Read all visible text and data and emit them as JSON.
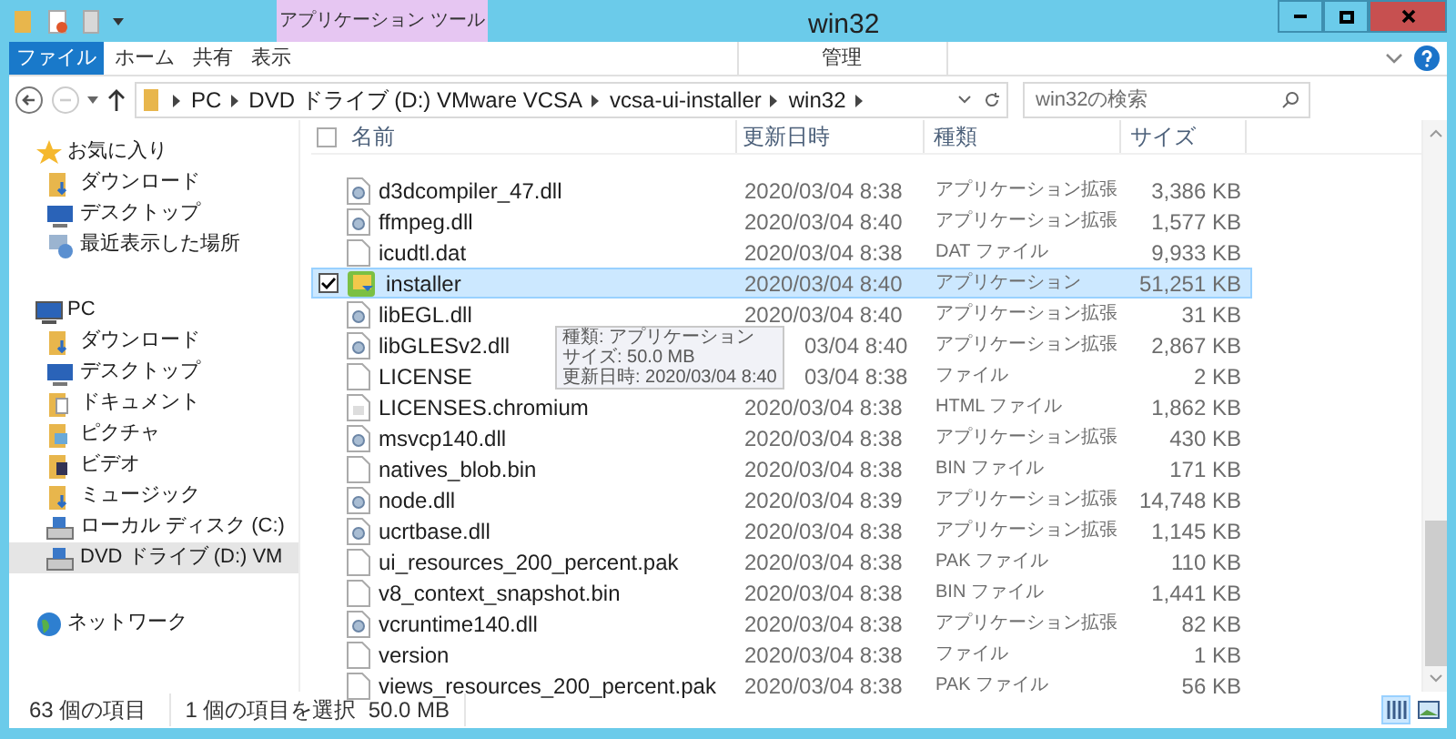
{
  "window": {
    "title": "win32",
    "context_tab": "アプリケーション ツール"
  },
  "ribbon_tabs": [
    {
      "label": "ファイル",
      "kind": "file"
    },
    {
      "label": "ホーム",
      "kind": "tab"
    },
    {
      "label": "共有",
      "kind": "tab"
    },
    {
      "label": "表示",
      "kind": "tab"
    },
    {
      "label": "管理",
      "kind": "context"
    }
  ],
  "address": {
    "crumbs": [
      "PC",
      "DVD ドライブ (D:) VMware VCSA",
      "vcsa-ui-installer",
      "win32"
    ]
  },
  "search": {
    "placeholder": "win32の検索"
  },
  "sidebar": {
    "groups": [
      {
        "label": "お気に入り",
        "kind": "star",
        "children": [
          {
            "label": "ダウンロード",
            "kind": "download",
            "selected": false
          },
          {
            "label": "デスクトップ",
            "kind": "desktop",
            "selected": false
          },
          {
            "label": "最近表示した場所",
            "kind": "recent",
            "selected": false
          }
        ]
      },
      {
        "label": "PC",
        "kind": "pc",
        "children": [
          {
            "label": "ダウンロード",
            "kind": "download",
            "selected": false
          },
          {
            "label": "デスクトップ",
            "kind": "desktop",
            "selected": false
          },
          {
            "label": "ドキュメント",
            "kind": "document",
            "selected": false
          },
          {
            "label": "ピクチャ",
            "kind": "folder",
            "selected": false
          },
          {
            "label": "ビデオ",
            "kind": "video",
            "selected": false
          },
          {
            "label": "ミュージック",
            "kind": "download",
            "selected": false
          },
          {
            "label": "ローカル ディスク (C:)",
            "kind": "disk",
            "selected": false
          },
          {
            "label": "DVD ドライブ (D:) VM",
            "kind": "disk",
            "selected": true
          }
        ]
      },
      {
        "label": "ネットワーク",
        "kind": "network"
      }
    ]
  },
  "table": {
    "select_all": {
      "checked": false
    },
    "columns": [
      "名前",
      "更新日時",
      "種類",
      "サイズ"
    ],
    "rows": [
      {
        "name": "d3dcompiler_47.dll",
        "kind": "dll",
        "date": "2020/03/04 8:38",
        "type": "アプリケーション拡張",
        "size": "3,386 KB",
        "selected": false
      },
      {
        "name": "ffmpeg.dll",
        "kind": "dll",
        "date": "2020/03/04 8:40",
        "type": "アプリケーション拡張",
        "size": "1,577 KB",
        "selected": false
      },
      {
        "name": "icudtl.dat",
        "kind": "file",
        "date": "2020/03/04 8:38",
        "type": "DAT ファイル",
        "size": "9,933 KB",
        "selected": false
      },
      {
        "name": "installer",
        "kind": "app",
        "date": "2020/03/04 8:40",
        "type": "アプリケーション",
        "size": "51,251 KB",
        "selected": true
      },
      {
        "name": "libEGL.dll",
        "kind": "dll",
        "date": "2020/03/04 8:40",
        "type": "アプリケーション拡張",
        "size": "31 KB",
        "selected": false
      },
      {
        "name": "libGLESv2.dll",
        "kind": "dll",
        "date": "03/04 8:40",
        "date_clipped": true,
        "type": "アプリケーション拡張",
        "size": "2,867 KB",
        "selected": false
      },
      {
        "name": "LICENSE",
        "kind": "file",
        "date": "03/04 8:38",
        "date_clipped": true,
        "type": "ファイル",
        "size": "2 KB",
        "selected": false
      },
      {
        "name": "LICENSES.chromium",
        "kind": "html",
        "date": "2020/03/04 8:38",
        "type": "HTML ファイル",
        "size": "1,862 KB",
        "selected": false
      },
      {
        "name": "msvcp140.dll",
        "kind": "dll",
        "date": "2020/03/04 8:38",
        "type": "アプリケーション拡張",
        "size": "430 KB",
        "selected": false
      },
      {
        "name": "natives_blob.bin",
        "kind": "file",
        "date": "2020/03/04 8:38",
        "type": "BIN ファイル",
        "size": "171 KB",
        "selected": false
      },
      {
        "name": "node.dll",
        "kind": "dll",
        "date": "2020/03/04 8:39",
        "type": "アプリケーション拡張",
        "size": "14,748 KB",
        "selected": false
      },
      {
        "name": "ucrtbase.dll",
        "kind": "dll",
        "date": "2020/03/04 8:38",
        "type": "アプリケーション拡張",
        "size": "1,145 KB",
        "selected": false
      },
      {
        "name": "ui_resources_200_percent.pak",
        "kind": "file",
        "date": "2020/03/04 8:38",
        "type": "PAK ファイル",
        "size": "110 KB",
        "selected": false
      },
      {
        "name": "v8_context_snapshot.bin",
        "kind": "file",
        "date": "2020/03/04 8:38",
        "type": "BIN ファイル",
        "size": "1,441 KB",
        "selected": false
      },
      {
        "name": "vcruntime140.dll",
        "kind": "dll",
        "date": "2020/03/04 8:38",
        "type": "アプリケーション拡張",
        "size": "82 KB",
        "selected": false
      },
      {
        "name": "version",
        "kind": "file",
        "date": "2020/03/04 8:38",
        "type": "ファイル",
        "size": "1 KB",
        "selected": false
      },
      {
        "name": "views_resources_200_percent.pak",
        "kind": "file",
        "date": "2020/03/04 8:38",
        "type": "PAK ファイル",
        "size": "56 KB",
        "selected": false
      }
    ]
  },
  "tooltip": {
    "lines": [
      "種類: アプリケーション",
      "サイズ: 50.0 MB",
      "更新日時: 2020/03/04 8:40"
    ]
  },
  "status_bar": {
    "count": "63 個の項目",
    "selection": "1 個の項目を選択  50.0 MB"
  },
  "view_buttons": [
    {
      "kind": "details",
      "selected": true
    },
    {
      "kind": "large",
      "selected": false
    }
  ]
}
